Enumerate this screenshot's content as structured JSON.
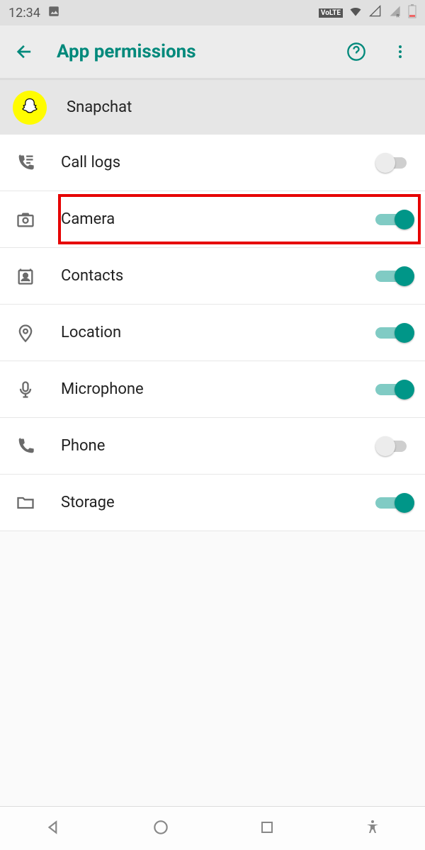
{
  "status": {
    "time": "12:34",
    "volte": "VoLTE"
  },
  "header": {
    "title": "App permissions"
  },
  "app": {
    "name": "Snapchat"
  },
  "permissions": [
    {
      "id": "call-logs",
      "label": "Call logs",
      "enabled": false,
      "icon": "call-logs-icon"
    },
    {
      "id": "camera",
      "label": "Camera",
      "enabled": true,
      "icon": "camera-icon",
      "highlighted": true
    },
    {
      "id": "contacts",
      "label": "Contacts",
      "enabled": true,
      "icon": "contacts-icon"
    },
    {
      "id": "location",
      "label": "Location",
      "enabled": true,
      "icon": "location-icon"
    },
    {
      "id": "microphone",
      "label": "Microphone",
      "enabled": true,
      "icon": "microphone-icon"
    },
    {
      "id": "phone",
      "label": "Phone",
      "enabled": false,
      "icon": "phone-icon"
    },
    {
      "id": "storage",
      "label": "Storage",
      "enabled": true,
      "icon": "storage-icon"
    }
  ],
  "colors": {
    "accent": "#009688",
    "highlight": "#e60000"
  }
}
